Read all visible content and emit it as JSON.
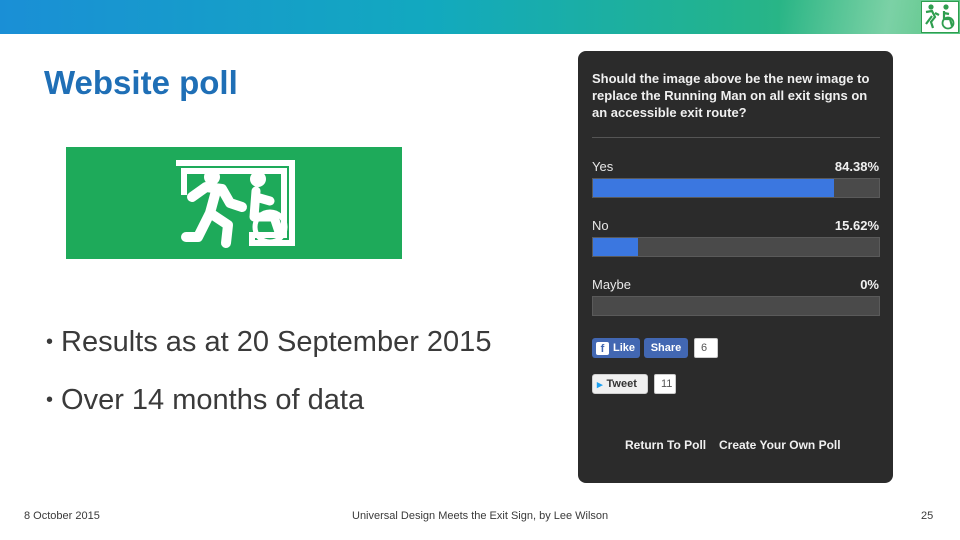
{
  "slide": {
    "title": "Website poll",
    "bullets": [
      "Results as at 20 September 2015",
      "Over 14 months of data"
    ]
  },
  "poll": {
    "question": "Should the image above be the new image to replace the Running Man on all exit signs on an accessible exit route?",
    "options": [
      {
        "label": "Yes",
        "percent_text": "84.38%",
        "value": 84.38
      },
      {
        "label": "No",
        "percent_text": "15.62%",
        "value": 15.62
      },
      {
        "label": "Maybe",
        "percent_text": "0%",
        "value": 0
      }
    ],
    "social": {
      "like_label": "Like",
      "share_label": "Share",
      "facebook_count": "6",
      "tweet_label": "Tweet",
      "tweet_count": "11"
    },
    "links": {
      "return": "Return To Poll",
      "create": "Create Your Own Poll"
    }
  },
  "footer": {
    "date": "8 October 2015",
    "center": "Universal Design Meets the Exit Sign, by Lee Wilson",
    "page": "25"
  },
  "colors": {
    "title": "#1f6fb6",
    "exit_sign_green": "#1eaa5a",
    "poll_background": "#2b2b2b",
    "bar_fill": "#3b77e0",
    "facebook_blue": "#4267b2"
  },
  "icons": {
    "exit_sign": "accessible-exit-sign-icon",
    "corner_logo": "accessible-exit-logo-icon",
    "facebook": "facebook-icon",
    "twitter": "twitter-bird-icon"
  }
}
